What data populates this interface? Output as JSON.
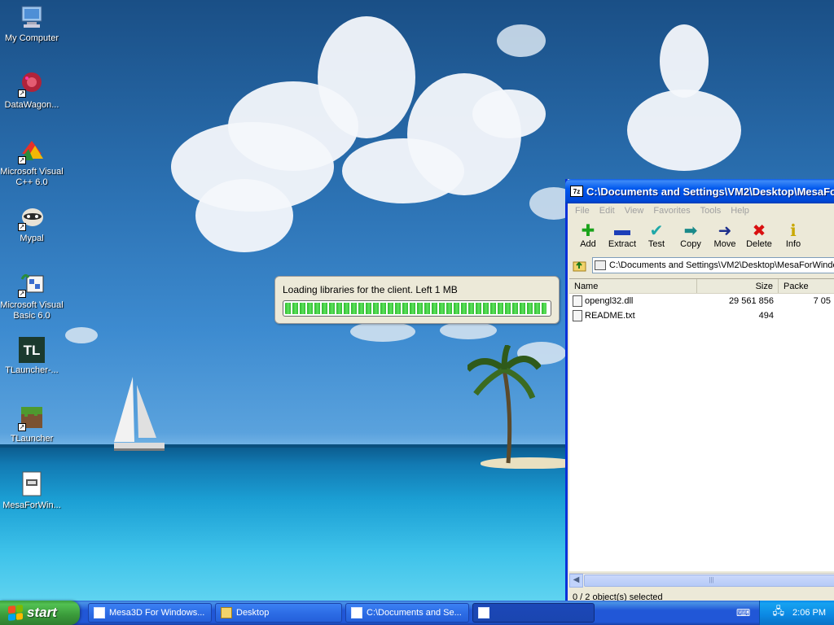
{
  "desktop": {
    "icons": [
      {
        "label": "My Computer"
      },
      {
        "label": "DataWagon..."
      },
      {
        "label": "Microsoft Visual C++ 6.0"
      },
      {
        "label": "Mypal"
      },
      {
        "label": "Microsoft Visual Basic 6.0"
      },
      {
        "label": "TLauncher-..."
      },
      {
        "label": "TLauncher"
      },
      {
        "label": "MesaForWin..."
      }
    ],
    "tlauncher_logo_text": "TL"
  },
  "loading": {
    "message": "Loading libraries for the client. Left 1 MB",
    "progress_percent": 99
  },
  "window": {
    "title": "C:\\Documents and Settings\\VM2\\Desktop\\MesaFor",
    "title_icon_text": "7z",
    "menu": [
      "File",
      "Edit",
      "View",
      "Favorites",
      "Tools",
      "Help"
    ],
    "toolbar": [
      {
        "label": "Add",
        "icon": "plus-icon",
        "color": "#1aa31a"
      },
      {
        "label": "Extract",
        "icon": "minus-icon",
        "color": "#1d3fb8"
      },
      {
        "label": "Test",
        "icon": "check-icon",
        "color": "#1fa8a8"
      },
      {
        "label": "Copy",
        "icon": "copy-arrow-icon",
        "color": "#1a8a8a"
      },
      {
        "label": "Move",
        "icon": "move-arrow-icon",
        "color": "#1d2f8c"
      },
      {
        "label": "Delete",
        "icon": "x-icon",
        "color": "#d91010"
      },
      {
        "label": "Info",
        "icon": "info-icon",
        "color": "#c9a800"
      }
    ],
    "address": "C:\\Documents and Settings\\VM2\\Desktop\\MesaForWindo",
    "columns": {
      "name": "Name",
      "size": "Size",
      "packed": "Packe"
    },
    "files": [
      {
        "name": "opengl32.dll",
        "size": "29 561 856",
        "packed": "7 05"
      },
      {
        "name": "README.txt",
        "size": "494",
        "packed": ""
      }
    ],
    "status": "0 / 2 object(s) selected"
  },
  "taskbar": {
    "start_label": "start",
    "buttons": [
      {
        "label": "Mesa3D For Windows...",
        "icon": "mesa-icon"
      },
      {
        "label": "Desktop",
        "icon": "folder-icon"
      },
      {
        "label": "C:\\Documents and Se...",
        "icon": "sevenzip-icon"
      },
      {
        "label": "",
        "icon": "java-icon"
      }
    ],
    "clock": "2:06 PM"
  },
  "colors": {
    "taskbar_blue": "#2157d7",
    "start_green": "#3a9a3a",
    "title_blue": "#0058ee",
    "progress_green": "#2fba2f"
  }
}
